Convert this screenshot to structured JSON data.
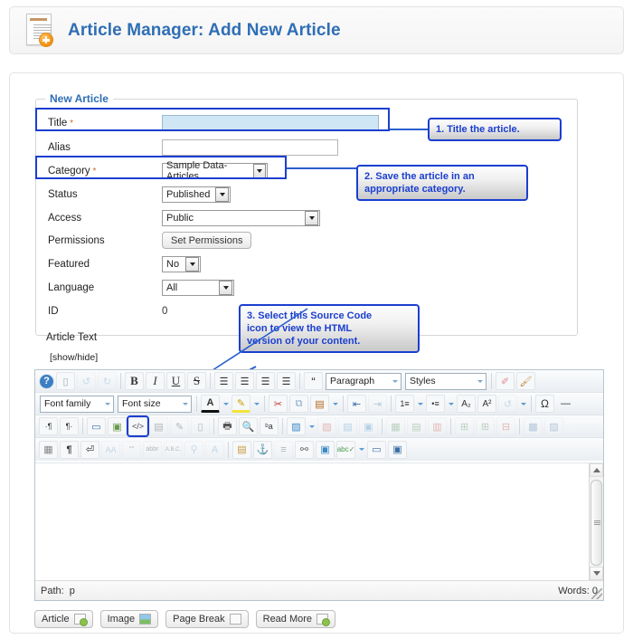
{
  "header": {
    "icon": "new-article-icon",
    "title": "Article Manager: Add New Article"
  },
  "form": {
    "legend": "New Article",
    "rows": [
      {
        "label": "Title",
        "required": true,
        "control": "text",
        "value": ""
      },
      {
        "label": "Alias",
        "required": false,
        "control": "text",
        "value": ""
      },
      {
        "label": "Category",
        "required": true,
        "control": "select",
        "value": "Sample Data-Articles"
      },
      {
        "label": "Status",
        "required": false,
        "control": "select",
        "value": "Published"
      },
      {
        "label": "Access",
        "required": false,
        "control": "select",
        "value": "Public"
      },
      {
        "label": "Permissions",
        "required": false,
        "control": "button",
        "value": "Set Permissions"
      },
      {
        "label": "Featured",
        "required": false,
        "control": "select",
        "value": "No"
      },
      {
        "label": "Language",
        "required": false,
        "control": "select",
        "value": "All"
      },
      {
        "label": "ID",
        "required": false,
        "control": "static",
        "value": "0"
      }
    ],
    "article_text_label": "Article Text",
    "show_hide_label": "[show/hide]"
  },
  "callouts": [
    {
      "id": "callout-1",
      "text": "1. Title the article."
    },
    {
      "id": "callout-2",
      "line1": "2. Save the article in an",
      "line2": "appropriate category."
    },
    {
      "id": "callout-3",
      "line1": "3. Select this Source Code",
      "line2": "icon to view the HTML",
      "line3": "version of your content."
    }
  ],
  "editor": {
    "toolbar_row1": [
      {
        "name": "help-icon",
        "glyph": "?"
      },
      {
        "name": "new-document-icon",
        "glyph": "▯"
      },
      {
        "name": "undo-icon",
        "glyph": "↶",
        "disabled": true
      },
      {
        "name": "redo-icon",
        "glyph": "↷",
        "disabled": true
      },
      {
        "name": "bold-icon",
        "glyph": "B"
      },
      {
        "name": "italic-icon",
        "glyph": "I"
      },
      {
        "name": "underline-icon",
        "glyph": "U"
      },
      {
        "name": "strikethrough-icon",
        "glyph": "S"
      },
      {
        "name": "align-left-icon",
        "glyph": "≡"
      },
      {
        "name": "align-center-icon",
        "glyph": "≡"
      },
      {
        "name": "align-right-icon",
        "glyph": "≡"
      },
      {
        "name": "align-justify-icon",
        "glyph": "≡"
      },
      {
        "name": "blockquote-icon",
        "glyph": "“"
      }
    ],
    "paragraph_select": "Paragraph",
    "styles_select": "Styles",
    "toolbar_row1_end": [
      {
        "name": "eraser-icon",
        "glyph": "✐"
      },
      {
        "name": "cleanup-icon",
        "glyph": "🖌"
      }
    ],
    "font_family_select": "Font family",
    "font_size_select": "Font size",
    "toolbar_row2": [
      {
        "name": "text-color-icon",
        "glyph": "A"
      },
      {
        "name": "background-color-icon",
        "glyph": "✎"
      },
      {
        "name": "cut-icon",
        "glyph": "✂"
      },
      {
        "name": "copy-icon",
        "glyph": "⧉"
      },
      {
        "name": "paste-icon",
        "glyph": "📋"
      },
      {
        "name": "outdent-icon",
        "glyph": "⇤"
      },
      {
        "name": "indent-icon",
        "glyph": "⇥",
        "disabled": true
      },
      {
        "name": "numbered-list-icon",
        "glyph": "1⋮"
      },
      {
        "name": "bulleted-list-icon",
        "glyph": "•⋮"
      },
      {
        "name": "subscript-icon",
        "glyph": "A₂"
      },
      {
        "name": "superscript-icon",
        "glyph": "A²"
      },
      {
        "name": "undo-history-icon",
        "glyph": "↺",
        "disabled": true
      },
      {
        "name": "special-character-icon",
        "glyph": "Ω"
      },
      {
        "name": "horizontal-rule-icon",
        "glyph": "—"
      }
    ],
    "toolbar_row3": [
      {
        "name": "ltr-direction-icon",
        "glyph": "·¶"
      },
      {
        "name": "rtl-direction-icon",
        "glyph": "¶·"
      },
      {
        "name": "fullscreen-icon",
        "glyph": "🖥"
      },
      {
        "name": "insert-image-icon",
        "glyph": "🖼"
      },
      {
        "name": "source-code-icon",
        "glyph": "{;}",
        "highlight": true
      },
      {
        "name": "template-icon",
        "glyph": "▤",
        "disabled": true
      },
      {
        "name": "edit-css-icon",
        "glyph": "✎",
        "disabled": true
      },
      {
        "name": "page-icon",
        "glyph": "▯",
        "disabled": true
      },
      {
        "name": "print-icon",
        "glyph": "🖨"
      },
      {
        "name": "search-icon",
        "glyph": "🔍"
      },
      {
        "name": "replace-icon",
        "glyph": "ᵇa"
      },
      {
        "name": "insert-link-icon",
        "glyph": "🔗"
      },
      {
        "name": "unlink-icon",
        "glyph": "⛓",
        "disabled": true
      },
      {
        "name": "anchor-icon",
        "glyph": "⚓",
        "disabled": true
      },
      {
        "name": "media-icon",
        "glyph": "▣",
        "disabled": true
      },
      {
        "name": "table-icon",
        "glyph": "▦",
        "disabled": true
      },
      {
        "name": "row-props-icon",
        "glyph": "▤",
        "disabled": true
      },
      {
        "name": "cell-props-icon",
        "glyph": "▥",
        "disabled": true
      },
      {
        "name": "insert-row-before-icon",
        "glyph": "⊞",
        "disabled": true
      },
      {
        "name": "insert-row-after-icon",
        "glyph": "⊞",
        "disabled": true
      },
      {
        "name": "delete-row-icon",
        "glyph": "⊟",
        "disabled": true
      },
      {
        "name": "insert-col-icon",
        "glyph": "▩",
        "disabled": true
      },
      {
        "name": "delete-col-icon",
        "glyph": "▨",
        "disabled": true
      }
    ],
    "toolbar_row4": [
      {
        "name": "visual-aid-icon",
        "glyph": "▦"
      },
      {
        "name": "show-invisible-icon",
        "glyph": "¶"
      },
      {
        "name": "insert-nbsp-icon",
        "glyph": "⏎"
      },
      {
        "name": "abbreviation-icon",
        "glyph": "AA",
        "disabled": true
      },
      {
        "name": "quote-icon",
        "glyph": "“”",
        "disabled": true
      },
      {
        "name": "acronym-icon",
        "glyph": "abbr",
        "disabled": true
      },
      {
        "name": "definition-icon",
        "glyph": "A.B.C.",
        "disabled": true
      },
      {
        "name": "attribs-icon",
        "glyph": "⚲",
        "disabled": true
      },
      {
        "name": "del-icon",
        "glyph": "A",
        "disabled": true
      },
      {
        "name": "insert-note-icon",
        "glyph": "🗒"
      },
      {
        "name": "insert-anchor-icon",
        "glyph": "⚓"
      },
      {
        "name": "citation-icon",
        "glyph": "≡",
        "disabled": true
      },
      {
        "name": "insert-hr-icon",
        "glyph": "⚯"
      },
      {
        "name": "insert-picture-icon",
        "glyph": "🖼"
      },
      {
        "name": "spellcheck-icon",
        "glyph": "abc✓"
      },
      {
        "name": "insert-pagebreak-icon",
        "glyph": "▭"
      },
      {
        "name": "layer-icon",
        "glyph": "▣"
      }
    ],
    "path_label": "Path:",
    "path_value": "p",
    "words_label": "Words: 0"
  },
  "bottom_buttons": [
    {
      "label": "Article",
      "icon": "article-icon"
    },
    {
      "label": "Image",
      "icon": "image-icon"
    },
    {
      "label": "Page Break",
      "icon": "page-break-icon"
    },
    {
      "label": "Read More",
      "icon": "read-more-icon"
    }
  ]
}
